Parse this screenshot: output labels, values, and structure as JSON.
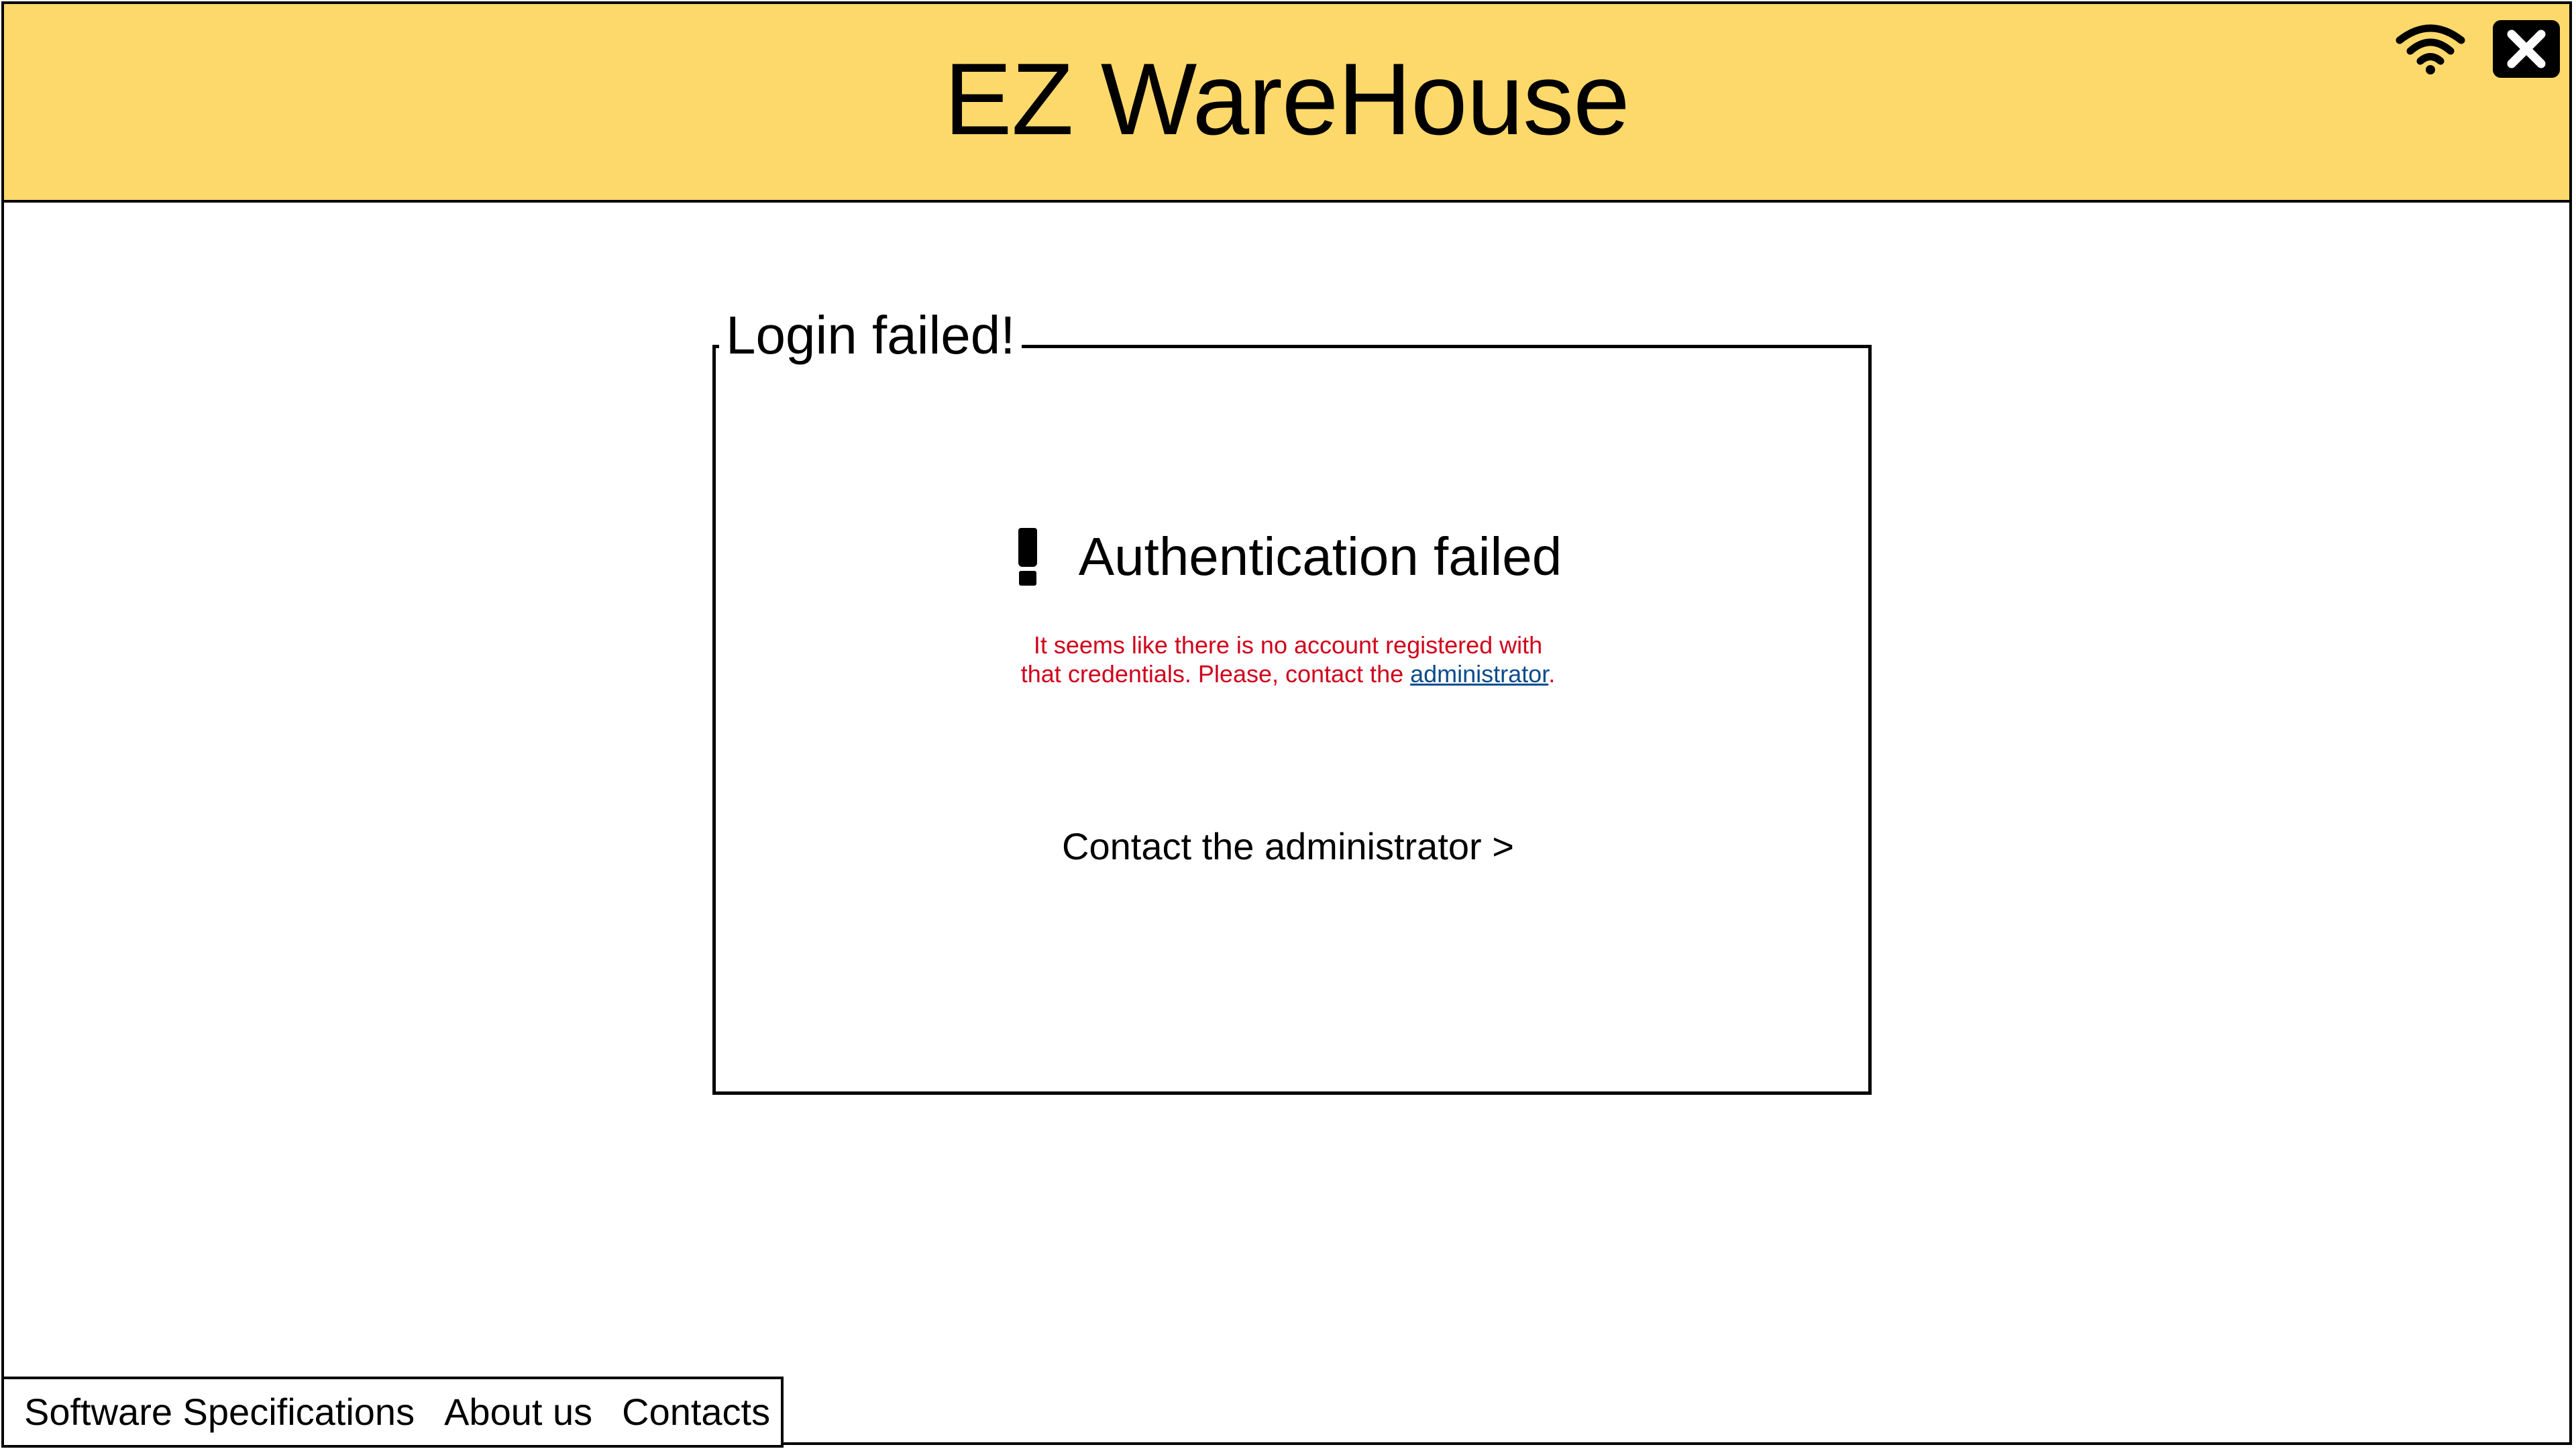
{
  "app": {
    "title": "EZ WareHouse",
    "header_color": "#fdd96b"
  },
  "header": {
    "status_icons": [
      "wifi-icon",
      "close-icon"
    ]
  },
  "login_panel": {
    "legend": "Login failed!",
    "alert": {
      "icon": "exclamation-icon",
      "title": "Authentication failed",
      "message_before_link": "It seems like there is no account registered with that credentials. Please, contact the ",
      "message_link": "administrator",
      "message_after_link": ".",
      "message_color": "#d0021b",
      "link_color": "#0a4b8c"
    },
    "contact_link": "Contact the administrator >"
  },
  "footer": {
    "links": [
      {
        "label": "Software Specifications"
      },
      {
        "label": "About us"
      },
      {
        "label": "Contacts"
      }
    ]
  }
}
